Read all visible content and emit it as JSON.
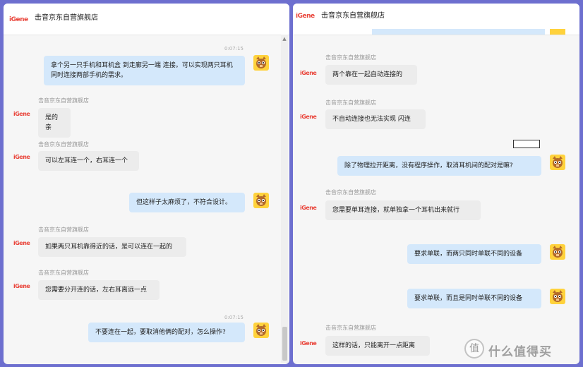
{
  "left": {
    "logo": "iGene",
    "title": "击音京东自营旗舰店",
    "top_stamp": "0:07:15",
    "shop_name": "击音京东自营旗舰店",
    "messages": [
      {
        "text": "拿个另一只手机和耳机盒 到走廊另一端 连接。可以实现两只耳机同时连接两部手机的需求。"
      },
      {
        "text": "是的亲"
      },
      {
        "text": "可以左耳连一个，右耳连一个"
      },
      {
        "text": "但这样子太麻烦了，不符合设计。"
      },
      {
        "text": "如果两只耳机靠得近的话，是可以连在一起的"
      },
      {
        "text": "您需要分开连的话，左右耳离远一点"
      },
      {
        "text": "不要连在一起，要取消他俩的配对，怎么操作?"
      }
    ],
    "bottom_stamp": "0:07:15"
  },
  "right": {
    "logo": "iGene",
    "title": "击音京东自营旗舰店",
    "shop_name": "击音京东自营旗舰店",
    "messages": [
      {
        "text": "两个靠在一起自动连接的"
      },
      {
        "text": "不自动连接也无法实现 闪连"
      },
      {
        "text": "除了物理拉开距离，没有程序操作，取消耳机间的配对是嘛?"
      },
      {
        "text": "您需要单耳连接，就单独拿一个耳机出来就行"
      },
      {
        "text": "要求单联，而两只同时单联不同的设备"
      },
      {
        "text": "要求单联，而且是同时单联不同的设备"
      },
      {
        "text": "这样的话，只能离开一点距离"
      }
    ]
  },
  "watermark": {
    "icon": "值",
    "text": "什么值得买"
  },
  "colors": {
    "background": "#6d6fcf",
    "outgoing_bubble": "#d4e8fb",
    "incoming_bubble": "#ececec",
    "brand_red": "#e9453b"
  }
}
